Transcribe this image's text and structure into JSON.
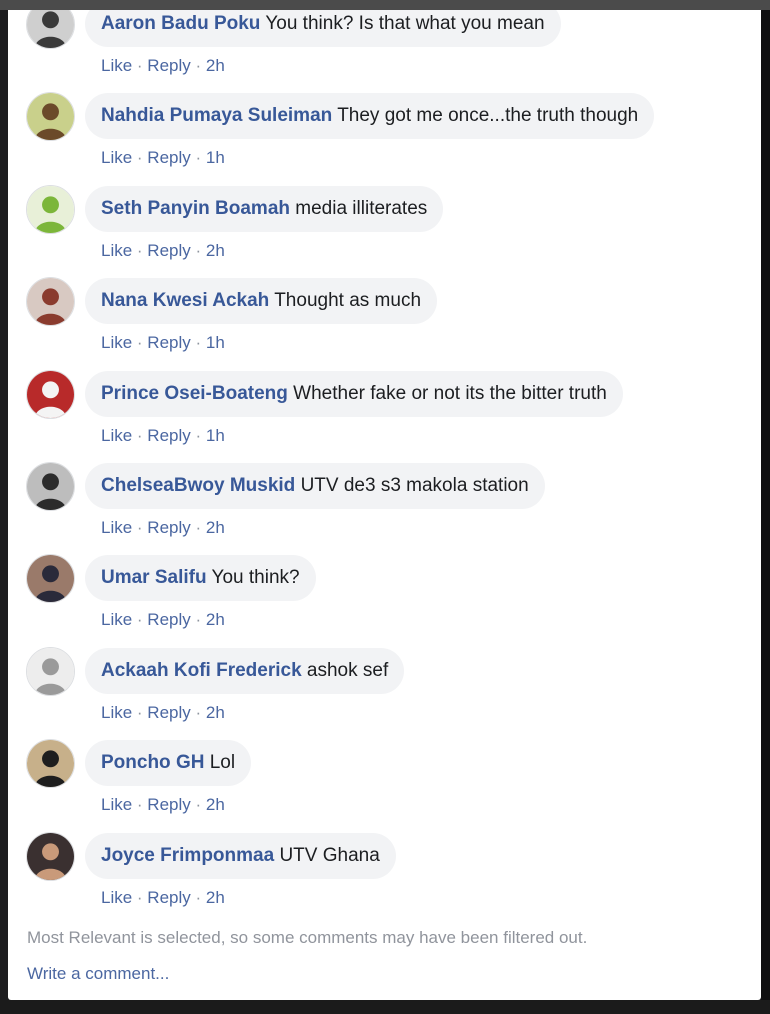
{
  "comments": [
    {
      "author": "Aaron Badu Poku",
      "text": "You think? Is that what you mean",
      "like": "Like",
      "reply": "Reply",
      "time": "2h",
      "avatar_bg": "#cfcfcf",
      "avatar_fg": "#3a3a3a",
      "avatar_icon": "avatar-photo-icon"
    },
    {
      "author": "Nahdia Pumaya Suleiman",
      "text": "They got me once...the truth though",
      "like": "Like",
      "reply": "Reply",
      "time": "1h",
      "avatar_bg": "#c9d08b",
      "avatar_fg": "#6b4a2a",
      "avatar_icon": "avatar-photo-icon"
    },
    {
      "author": "Seth Panyin Boamah",
      "text": "media illiterates",
      "like": "Like",
      "reply": "Reply",
      "time": "2h",
      "avatar_bg": "#e8f0d8",
      "avatar_fg": "#7cb63a",
      "avatar_icon": "avatar-photo-icon"
    },
    {
      "author": "Nana Kwesi Ackah",
      "text": "Thought as much",
      "like": "Like",
      "reply": "Reply",
      "time": "1h",
      "avatar_bg": "#d8c9c2",
      "avatar_fg": "#8a3b2e",
      "avatar_icon": "avatar-photo-icon"
    },
    {
      "author": "Prince Osei-Boateng",
      "text": "Whether fake or not its the bitter truth",
      "like": "Like",
      "reply": "Reply",
      "time": "1h",
      "avatar_bg": "#b82a2a",
      "avatar_fg": "#f4f4f4",
      "avatar_icon": "avatar-photo-icon"
    },
    {
      "author": "ChelseaBwoy Muskid",
      "text": "UTV de3 s3 makola station",
      "like": "Like",
      "reply": "Reply",
      "time": "2h",
      "avatar_bg": "#bdbdbd",
      "avatar_fg": "#2b2b2b",
      "avatar_icon": "avatar-photo-icon"
    },
    {
      "author": "Umar Salifu",
      "text": "You think?",
      "like": "Like",
      "reply": "Reply",
      "time": "2h",
      "avatar_bg": "#9a7a6a",
      "avatar_fg": "#2a2a3a",
      "avatar_icon": "avatar-photo-icon"
    },
    {
      "author": "Ackaah Kofi Frederick",
      "text": "ashok sef",
      "like": "Like",
      "reply": "Reply",
      "time": "2h",
      "avatar_bg": "#ededed",
      "avatar_fg": "#9a9a9a",
      "avatar_icon": "avatar-photo-icon"
    },
    {
      "author": "Poncho GH",
      "text": "Lol",
      "like": "Like",
      "reply": "Reply",
      "time": "2h",
      "avatar_bg": "#c7b08a",
      "avatar_fg": "#1e1e1e",
      "avatar_icon": "avatar-photo-icon"
    },
    {
      "author": "Joyce Frimponmaa",
      "text": "UTV Ghana",
      "like": "Like",
      "reply": "Reply",
      "time": "2h",
      "avatar_bg": "#3a3030",
      "avatar_fg": "#c99a7a",
      "avatar_icon": "avatar-photo-icon"
    }
  ],
  "footer": {
    "filter_note": "Most Relevant is selected, so some comments may have been filtered out.",
    "write_comment": "Write a comment..."
  }
}
